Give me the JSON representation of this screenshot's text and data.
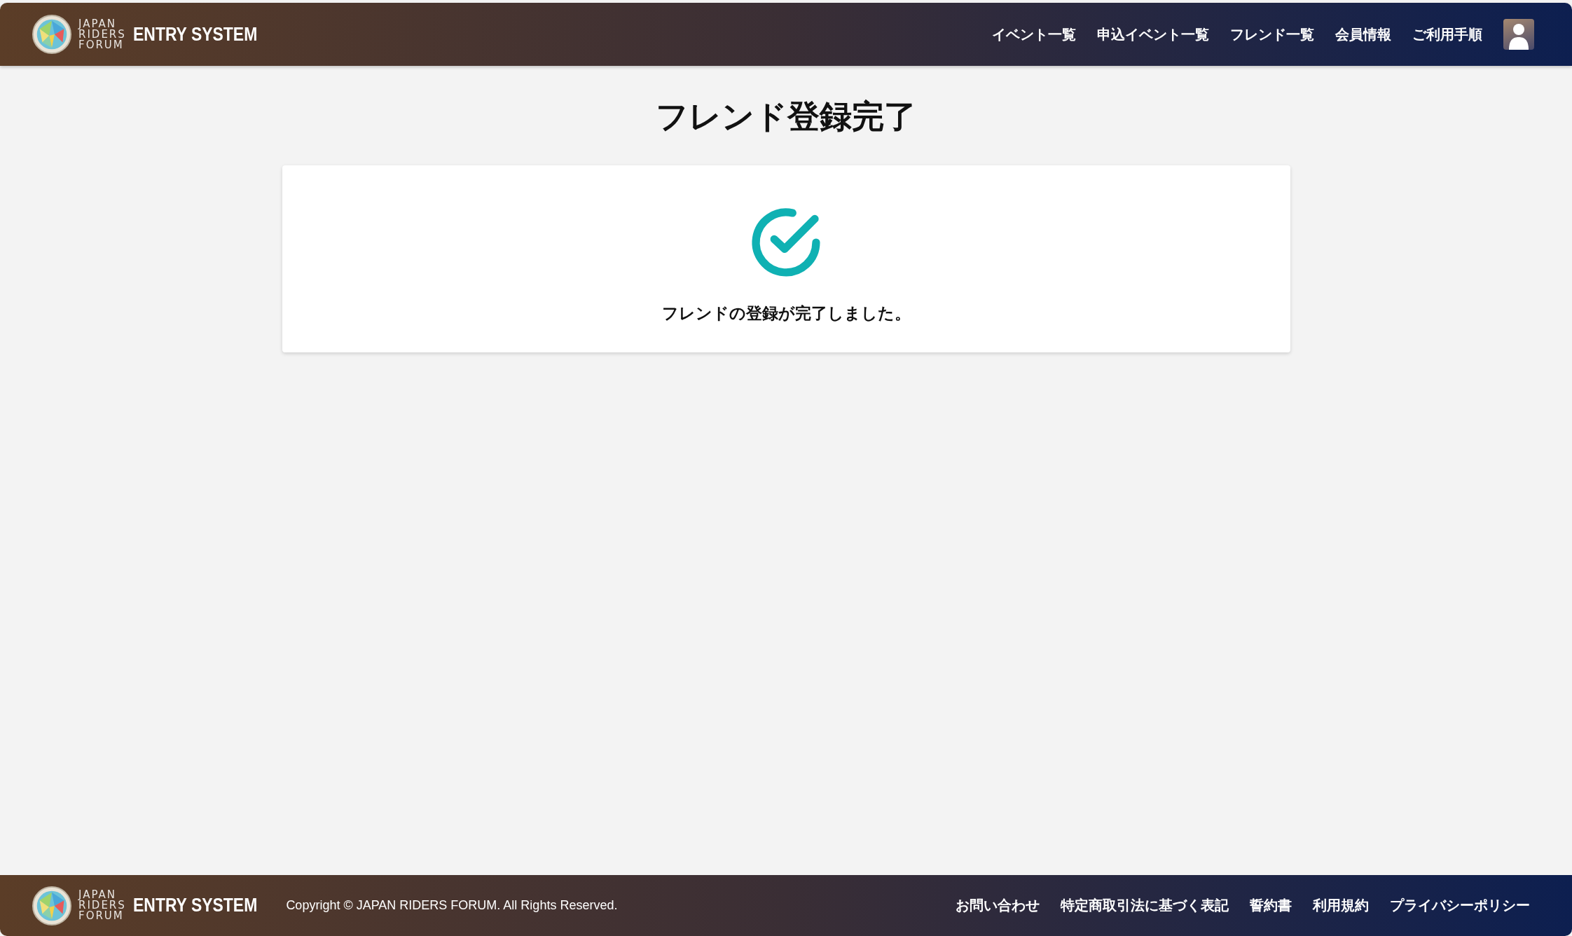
{
  "header": {
    "logo_lines": [
      "JAPAN",
      "RIDERS",
      "FORUM"
    ],
    "brand": "ENTRY SYSTEM",
    "nav": [
      "イベント一覧",
      "申込イベント一覧",
      "フレンド一覧",
      "会員情報",
      "ご利用手順"
    ]
  },
  "page_title": "フレンド登録完了",
  "card": {
    "message": "フレンドの登録が完了しました。"
  },
  "footer": {
    "logo_lines": [
      "JAPAN",
      "RIDERS",
      "FORUM"
    ],
    "brand": "ENTRY SYSTEM",
    "copyright": "Copyright © JAPAN RIDERS FORUM. All Rights Reserved.",
    "links": [
      "お問い合わせ",
      "特定商取引法に基づく表記",
      "誓約書",
      "利用規約",
      "プライバシーポリシー"
    ]
  }
}
